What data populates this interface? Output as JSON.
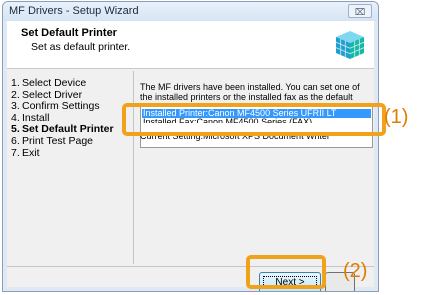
{
  "window": {
    "title": "MF Drivers - Setup Wizard",
    "close_glyph": "⌧"
  },
  "header": {
    "title": "Set Default Printer",
    "subtitle": "Set as default printer.",
    "icon": "installer-cube-icon"
  },
  "steps": [
    {
      "num": "1.",
      "label": "Select Device",
      "active": false
    },
    {
      "num": "2.",
      "label": "Select Driver",
      "active": false
    },
    {
      "num": "3.",
      "label": "Confirm Settings",
      "active": false
    },
    {
      "num": "4.",
      "label": "Install",
      "active": false
    },
    {
      "num": "5.",
      "label": "Set Default Printer",
      "active": true
    },
    {
      "num": "6.",
      "label": "Print Test Page",
      "active": false
    },
    {
      "num": "7.",
      "label": "Exit",
      "active": false
    }
  ],
  "main": {
    "description": "The MF drivers have been installed. You can set one of the installed printers or the installed fax as the default printer.",
    "list_items": [
      "Installed Printer:Canon MF4500 Series UFRII LT",
      "Installed Fax:Canon MF4500 Series (FAX)"
    ],
    "current_setting": "Current Setting:Microsoft XPS Document Writer"
  },
  "buttons": {
    "next_label": "Next >"
  },
  "annotations": {
    "callout_1": "(1)",
    "callout_2": "(2)",
    "highlight_color": "#f0a21a"
  }
}
